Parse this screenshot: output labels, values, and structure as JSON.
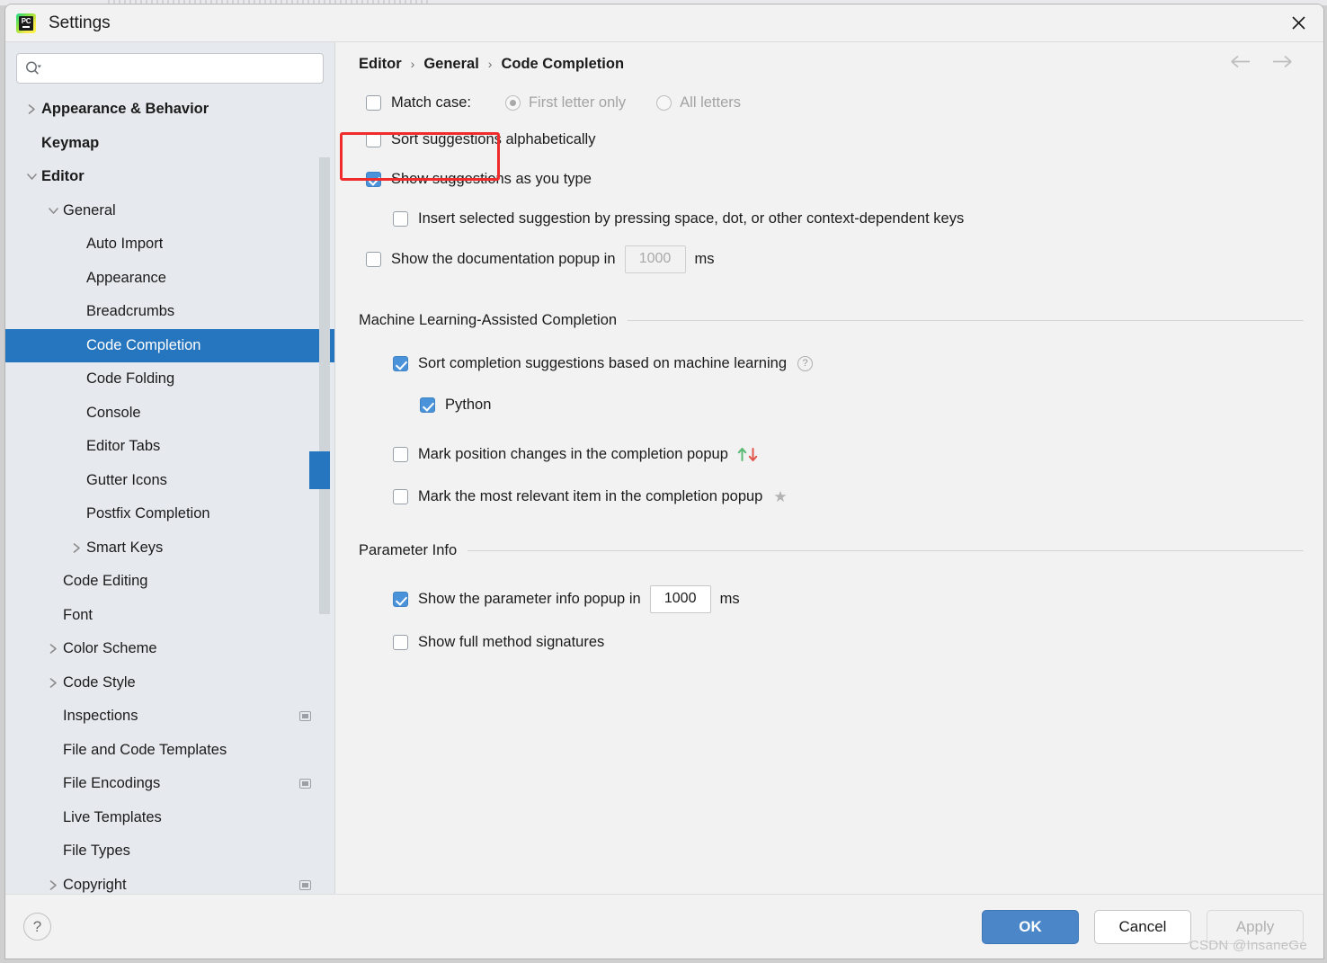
{
  "window": {
    "title": "Settings",
    "app_icon": "pycharm-icon",
    "close_icon": "close-icon"
  },
  "sidebar": {
    "search": {
      "placeholder": "",
      "value": "",
      "icon": "search-icon",
      "chevron": "chevron-down-icon"
    },
    "items": [
      {
        "label": "Appearance & Behavior",
        "level": 0,
        "twisty": "chevron-right",
        "bold": true,
        "selected": false,
        "scope_icon": false
      },
      {
        "label": "Keymap",
        "level": 0,
        "twisty": "none",
        "bold": true,
        "selected": false,
        "scope_icon": false
      },
      {
        "label": "Editor",
        "level": 0,
        "twisty": "chevron-down",
        "bold": true,
        "selected": false,
        "scope_icon": false
      },
      {
        "label": "General",
        "level": 1,
        "twisty": "chevron-down",
        "bold": false,
        "selected": false,
        "scope_icon": false
      },
      {
        "label": "Auto Import",
        "level": 2,
        "twisty": "none",
        "bold": false,
        "selected": false,
        "scope_icon": false
      },
      {
        "label": "Appearance",
        "level": 2,
        "twisty": "none",
        "bold": false,
        "selected": false,
        "scope_icon": false
      },
      {
        "label": "Breadcrumbs",
        "level": 2,
        "twisty": "none",
        "bold": false,
        "selected": false,
        "scope_icon": false
      },
      {
        "label": "Code Completion",
        "level": 2,
        "twisty": "none",
        "bold": false,
        "selected": true,
        "scope_icon": false
      },
      {
        "label": "Code Folding",
        "level": 2,
        "twisty": "none",
        "bold": false,
        "selected": false,
        "scope_icon": false
      },
      {
        "label": "Console",
        "level": 2,
        "twisty": "none",
        "bold": false,
        "selected": false,
        "scope_icon": false
      },
      {
        "label": "Editor Tabs",
        "level": 2,
        "twisty": "none",
        "bold": false,
        "selected": false,
        "scope_icon": false
      },
      {
        "label": "Gutter Icons",
        "level": 2,
        "twisty": "none",
        "bold": false,
        "selected": false,
        "scope_icon": false
      },
      {
        "label": "Postfix Completion",
        "level": 2,
        "twisty": "none",
        "bold": false,
        "selected": false,
        "scope_icon": false
      },
      {
        "label": "Smart Keys",
        "level": 2,
        "twisty": "chevron-right",
        "bold": false,
        "selected": false,
        "scope_icon": false
      },
      {
        "label": "Code Editing",
        "level": 1,
        "twisty": "none",
        "bold": false,
        "selected": false,
        "scope_icon": false
      },
      {
        "label": "Font",
        "level": 1,
        "twisty": "none",
        "bold": false,
        "selected": false,
        "scope_icon": false
      },
      {
        "label": "Color Scheme",
        "level": 1,
        "twisty": "chevron-right",
        "bold": false,
        "selected": false,
        "scope_icon": false
      },
      {
        "label": "Code Style",
        "level": 1,
        "twisty": "chevron-right",
        "bold": false,
        "selected": false,
        "scope_icon": false
      },
      {
        "label": "Inspections",
        "level": 1,
        "twisty": "none",
        "bold": false,
        "selected": false,
        "scope_icon": true
      },
      {
        "label": "File and Code Templates",
        "level": 1,
        "twisty": "none",
        "bold": false,
        "selected": false,
        "scope_icon": false
      },
      {
        "label": "File Encodings",
        "level": 1,
        "twisty": "none",
        "bold": false,
        "selected": false,
        "scope_icon": true
      },
      {
        "label": "Live Templates",
        "level": 1,
        "twisty": "none",
        "bold": false,
        "selected": false,
        "scope_icon": false
      },
      {
        "label": "File Types",
        "level": 1,
        "twisty": "none",
        "bold": false,
        "selected": false,
        "scope_icon": false
      },
      {
        "label": "Copyright",
        "level": 1,
        "twisty": "chevron-right",
        "bold": false,
        "selected": false,
        "scope_icon": true
      }
    ]
  },
  "main": {
    "breadcrumb": {
      "part1": "Editor",
      "part2": "General",
      "part3": "Code Completion",
      "separator": "›"
    },
    "nav": {
      "back_icon": "arrow-left-icon",
      "forward_icon": "arrow-right-icon"
    },
    "match_case": {
      "label": "Match case:",
      "checked": false,
      "highlight_color": "#ef2b2b",
      "radios": [
        {
          "label": "First letter only",
          "selected": true,
          "disabled": true
        },
        {
          "label": "All letters",
          "selected": false,
          "disabled": true
        }
      ]
    },
    "options": [
      {
        "label": "Sort suggestions alphabetically",
        "checked": false
      },
      {
        "label": "Show suggestions as you type",
        "checked": true
      },
      {
        "label": "Insert selected suggestion by pressing space, dot, or other context-dependent keys",
        "checked": false
      }
    ],
    "doc_popup": {
      "label": "Show the documentation popup in",
      "checked": false,
      "value": "1000",
      "unit": "ms",
      "field_disabled": true
    },
    "ml_section": {
      "title": "Machine Learning-Assisted Completion",
      "sort_ml": {
        "label": "Sort completion suggestions based on machine learning",
        "checked": true,
        "help_icon": "help-circle-icon"
      },
      "python": {
        "label": "Python",
        "checked": true
      },
      "mark_position": {
        "label": "Mark position changes in the completion popup",
        "checked": false,
        "icon_up_color": "#5bb974",
        "icon_down_color": "#e2574c"
      },
      "mark_relevant": {
        "label": "Mark the most relevant item in the completion popup",
        "checked": false,
        "icon": "star-icon"
      }
    },
    "param_section": {
      "title": "Parameter Info",
      "popup_delay": {
        "label": "Show the parameter info popup in",
        "checked": true,
        "value": "1000",
        "unit": "ms",
        "field_disabled": false
      },
      "full_signatures": {
        "label": "Show full method signatures",
        "checked": false
      }
    }
  },
  "footer": {
    "help_icon": "question-mark-icon",
    "ok_label": "OK",
    "cancel_label": "Cancel",
    "apply_label": "Apply",
    "watermark": "CSDN @InsaneGe",
    "accent_color": "#4a86c8"
  }
}
